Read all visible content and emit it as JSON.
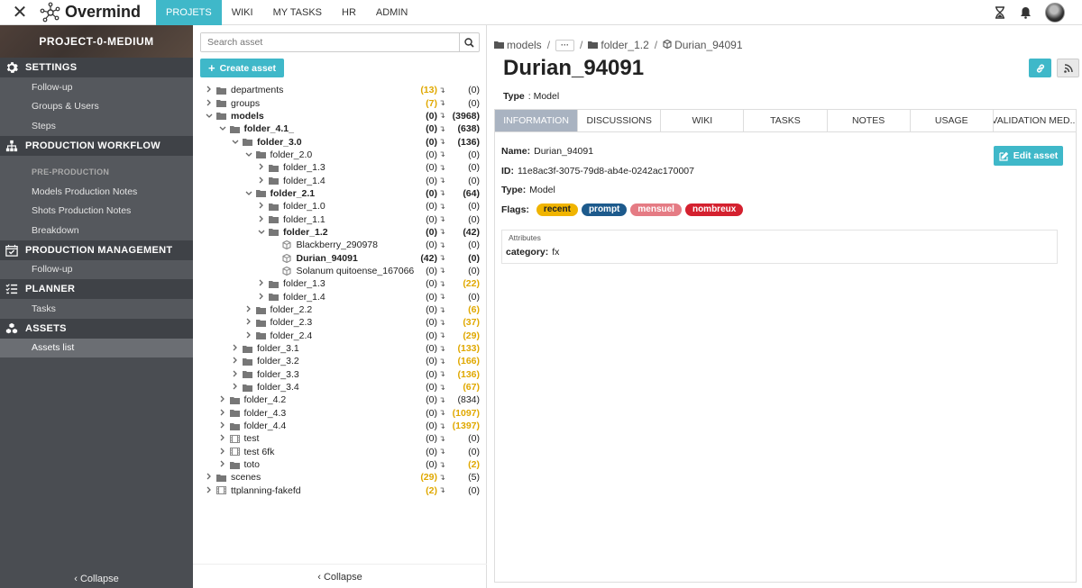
{
  "app": {
    "name": "Overmind"
  },
  "topnav": {
    "items": [
      {
        "label": "PROJETS",
        "active": true
      },
      {
        "label": "WIKI",
        "active": false
      },
      {
        "label": "MY TASKS",
        "active": false
      },
      {
        "label": "HR",
        "active": false
      },
      {
        "label": "ADMIN",
        "active": false
      }
    ],
    "icons": [
      "hourglass-icon",
      "bell-icon",
      "avatar"
    ]
  },
  "sidebar": {
    "project": "PROJECT-0-MEDIUM",
    "sections": {
      "settings": {
        "title": "SETTINGS",
        "items": [
          "Follow-up",
          "Groups & Users",
          "Steps"
        ]
      },
      "workflow": {
        "title": "PRODUCTION WORKFLOW",
        "sub": "PRE-PRODUCTION",
        "items": [
          "Models Production Notes",
          "Shots Production Notes",
          "Breakdown"
        ]
      },
      "management": {
        "title": "PRODUCTION MANAGEMENT",
        "items": [
          "Follow-up"
        ]
      },
      "planner": {
        "title": "PLANNER",
        "items": [
          "Tasks"
        ]
      },
      "assets": {
        "title": "ASSETS",
        "items": [
          "Assets list"
        ]
      }
    },
    "collapse": "Collapse"
  },
  "tree": {
    "search_placeholder": "Search asset",
    "create_label": "Create asset",
    "collapse": "Collapse",
    "rows": [
      {
        "label": "departments",
        "c1": "(13)",
        "c2": "(0)",
        "depth": 0,
        "type": "folder",
        "state": "closed",
        "c1warn": true
      },
      {
        "label": "groups",
        "c1": "(7)",
        "c2": "(0)",
        "depth": 0,
        "type": "folder",
        "state": "closed",
        "c1warn": true
      },
      {
        "label": "models",
        "c1": "(0)",
        "c2": "(3968)",
        "depth": 0,
        "type": "folder",
        "state": "open",
        "bold": true
      },
      {
        "label": "folder_4.1_",
        "c1": "(0)",
        "c2": "(638)",
        "depth": 1,
        "type": "folder",
        "state": "open",
        "bold": true
      },
      {
        "label": "folder_3.0",
        "c1": "(0)",
        "c2": "(136)",
        "depth": 2,
        "type": "folder",
        "state": "open",
        "bold": true
      },
      {
        "label": "folder_2.0",
        "c1": "(0)",
        "c2": "(0)",
        "depth": 3,
        "type": "folder",
        "state": "open"
      },
      {
        "label": "folder_1.3",
        "c1": "(0)",
        "c2": "(0)",
        "depth": 4,
        "type": "folder",
        "state": "closed"
      },
      {
        "label": "folder_1.4",
        "c1": "(0)",
        "c2": "(0)",
        "depth": 4,
        "type": "folder",
        "state": "closed"
      },
      {
        "label": "folder_2.1",
        "c1": "(0)",
        "c2": "(64)",
        "depth": 3,
        "type": "folder",
        "state": "open",
        "bold": true
      },
      {
        "label": "folder_1.0",
        "c1": "(0)",
        "c2": "(0)",
        "depth": 4,
        "type": "folder",
        "state": "closed"
      },
      {
        "label": "folder_1.1",
        "c1": "(0)",
        "c2": "(0)",
        "depth": 4,
        "type": "folder",
        "state": "closed"
      },
      {
        "label": "folder_1.2",
        "c1": "(0)",
        "c2": "(42)",
        "depth": 4,
        "type": "folder",
        "state": "open",
        "bold": true
      },
      {
        "label": "Blackberry_290978",
        "c1": "(0)",
        "c2": "(0)",
        "depth": 5,
        "type": "asset",
        "state": "none"
      },
      {
        "label": "Durian_94091",
        "c1": "(42)",
        "c2": "(0)",
        "depth": 5,
        "type": "asset",
        "state": "none",
        "bold": true
      },
      {
        "label": "Solanum quitoense_167066",
        "c1": "(0)",
        "c2": "(0)",
        "depth": 5,
        "type": "asset",
        "state": "none"
      },
      {
        "label": "folder_1.3",
        "c1": "(0)",
        "c2": "(22)",
        "depth": 4,
        "type": "folder",
        "state": "closed",
        "c2warn": true
      },
      {
        "label": "folder_1.4",
        "c1": "(0)",
        "c2": "(0)",
        "depth": 4,
        "type": "folder",
        "state": "closed"
      },
      {
        "label": "folder_2.2",
        "c1": "(0)",
        "c2": "(6)",
        "depth": 3,
        "type": "folder",
        "state": "closed",
        "c2warn": true
      },
      {
        "label": "folder_2.3",
        "c1": "(0)",
        "c2": "(37)",
        "depth": 3,
        "type": "folder",
        "state": "closed",
        "c2warn": true
      },
      {
        "label": "folder_2.4",
        "c1": "(0)",
        "c2": "(29)",
        "depth": 3,
        "type": "folder",
        "state": "closed",
        "c2warn": true
      },
      {
        "label": "folder_3.1",
        "c1": "(0)",
        "c2": "(133)",
        "depth": 2,
        "type": "folder",
        "state": "closed",
        "c2warn": true
      },
      {
        "label": "folder_3.2",
        "c1": "(0)",
        "c2": "(166)",
        "depth": 2,
        "type": "folder",
        "state": "closed",
        "c2warn": true
      },
      {
        "label": "folder_3.3",
        "c1": "(0)",
        "c2": "(136)",
        "depth": 2,
        "type": "folder",
        "state": "closed",
        "c2warn": true
      },
      {
        "label": "folder_3.4",
        "c1": "(0)",
        "c2": "(67)",
        "depth": 2,
        "type": "folder",
        "state": "closed",
        "c2warn": true
      },
      {
        "label": "folder_4.2",
        "c1": "(0)",
        "c2": "(834)",
        "depth": 1,
        "type": "folder",
        "state": "closed"
      },
      {
        "label": "folder_4.3",
        "c1": "(0)",
        "c2": "(1097)",
        "depth": 1,
        "type": "folder",
        "state": "closed",
        "c2warn": true
      },
      {
        "label": "folder_4.4",
        "c1": "(0)",
        "c2": "(1397)",
        "depth": 1,
        "type": "folder",
        "state": "closed",
        "c2warn": true
      },
      {
        "label": "test",
        "c1": "(0)",
        "c2": "(0)",
        "depth": 1,
        "type": "film",
        "state": "closed"
      },
      {
        "label": "test 6fk",
        "c1": "(0)",
        "c2": "(0)",
        "depth": 1,
        "type": "film",
        "state": "closed"
      },
      {
        "label": "toto",
        "c1": "(0)",
        "c2": "(2)",
        "depth": 1,
        "type": "folder",
        "state": "closed",
        "c2warn": true
      },
      {
        "label": "scenes",
        "c1": "(29)",
        "c2": "(5)",
        "depth": 0,
        "type": "folder",
        "state": "closed",
        "c1warn": true
      },
      {
        "label": "ttplanning-fakefd",
        "c1": "(2)",
        "c2": "(0)",
        "depth": 0,
        "type": "film",
        "state": "closed",
        "c1warn": true
      }
    ]
  },
  "detail": {
    "breadcrumb": {
      "root": "models",
      "more": "···",
      "parent": "folder_1.2",
      "current": "Durian_94091"
    },
    "title": "Durian_94091",
    "type_label": "Type",
    "type_value": ": Model",
    "tabs": [
      "INFORMATION",
      "DISCUSSIONS",
      "WIKI",
      "TASKS",
      "NOTES",
      "USAGE",
      "VALIDATION MED..."
    ],
    "active_tab": 0,
    "info": {
      "name_label": "Name:",
      "name_value": "Durian_94091",
      "id_label": "ID:",
      "id_value": "11e8ac3f-3075-79d8-ab4e-0242ac170007",
      "type_label": "Type:",
      "type_value": "Model",
      "flags_label": "Flags:",
      "flags": [
        {
          "label": "recent",
          "bg": "#f0b400",
          "fg": "#222"
        },
        {
          "label": "prompt",
          "bg": "#1d5a8c",
          "fg": "#fff"
        },
        {
          "label": "mensuel",
          "bg": "#e57b84",
          "fg": "#fff"
        },
        {
          "label": "nombreux",
          "bg": "#d4212f",
          "fg": "#fff"
        }
      ],
      "edit_label": "Edit asset",
      "attributes_title": "Attributes",
      "attr_key": "category:",
      "attr_value": "fx"
    }
  },
  "colors": {
    "accent": "#3fb8c9",
    "sidebar": "#4a4d52",
    "warn": "#e0a800"
  }
}
